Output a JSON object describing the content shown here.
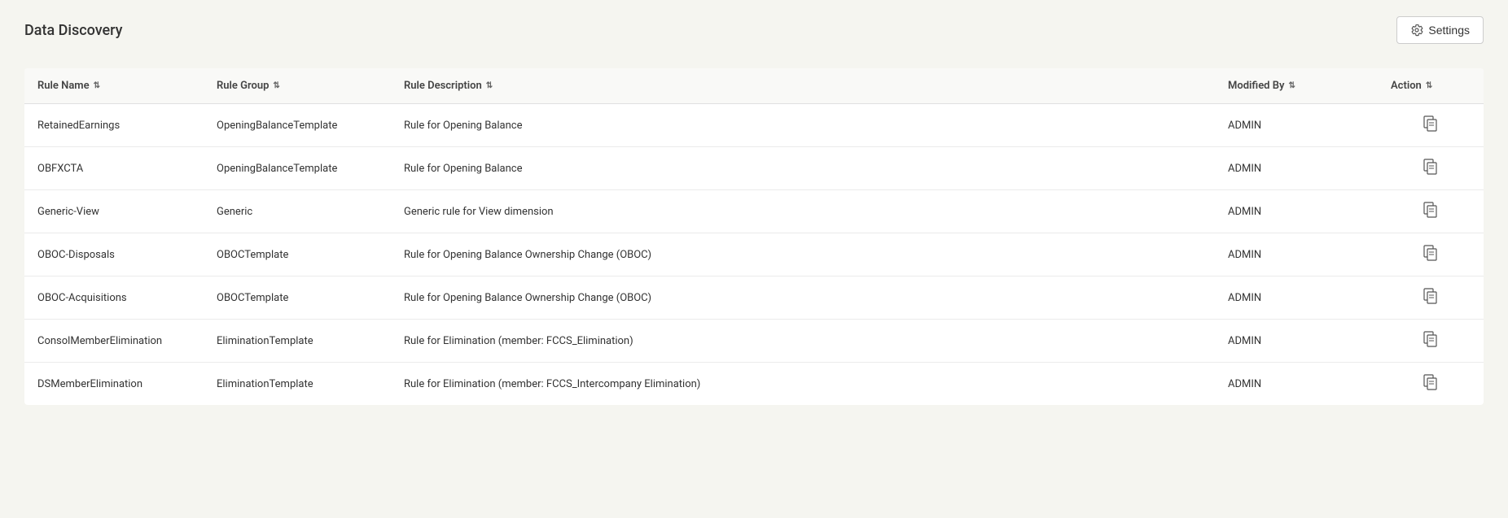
{
  "page": {
    "title": "Data Discovery",
    "settings_button_label": "Settings"
  },
  "table": {
    "columns": [
      {
        "id": "rule-name",
        "label": "Rule Name",
        "sortable": true
      },
      {
        "id": "rule-group",
        "label": "Rule Group",
        "sortable": true
      },
      {
        "id": "rule-description",
        "label": "Rule Description",
        "sortable": true
      },
      {
        "id": "modified-by",
        "label": "Modified By",
        "sortable": true
      },
      {
        "id": "action",
        "label": "Action",
        "sortable": true
      }
    ],
    "rows": [
      {
        "rule_name": "RetainedEarnings",
        "rule_group": "OpeningBalanceTemplate",
        "rule_description": "Rule for Opening Balance",
        "modified_by": "ADMIN"
      },
      {
        "rule_name": "OBFXCTA",
        "rule_group": "OpeningBalanceTemplate",
        "rule_description": "Rule for Opening Balance",
        "modified_by": "ADMIN"
      },
      {
        "rule_name": "Generic-View",
        "rule_group": "Generic",
        "rule_description": "Generic rule for View dimension",
        "modified_by": "ADMIN"
      },
      {
        "rule_name": "OBOC-Disposals",
        "rule_group": "OBOCTemplate",
        "rule_description": "Rule for Opening Balance Ownership Change (OBOC)",
        "modified_by": "ADMIN"
      },
      {
        "rule_name": "OBOC-Acquisitions",
        "rule_group": "OBOCTemplate",
        "rule_description": "Rule for Opening Balance Ownership Change (OBOC)",
        "modified_by": "ADMIN"
      },
      {
        "rule_name": "ConsolMemberElimination",
        "rule_group": "EliminationTemplate",
        "rule_description": "Rule for Elimination (member: FCCS_Elimination)",
        "modified_by": "ADMIN"
      },
      {
        "rule_name": "DSMemberElimination",
        "rule_group": "EliminationTemplate",
        "rule_description": "Rule for Elimination (member: FCCS_Intercompany Elimination)",
        "modified_by": "ADMIN"
      }
    ]
  }
}
